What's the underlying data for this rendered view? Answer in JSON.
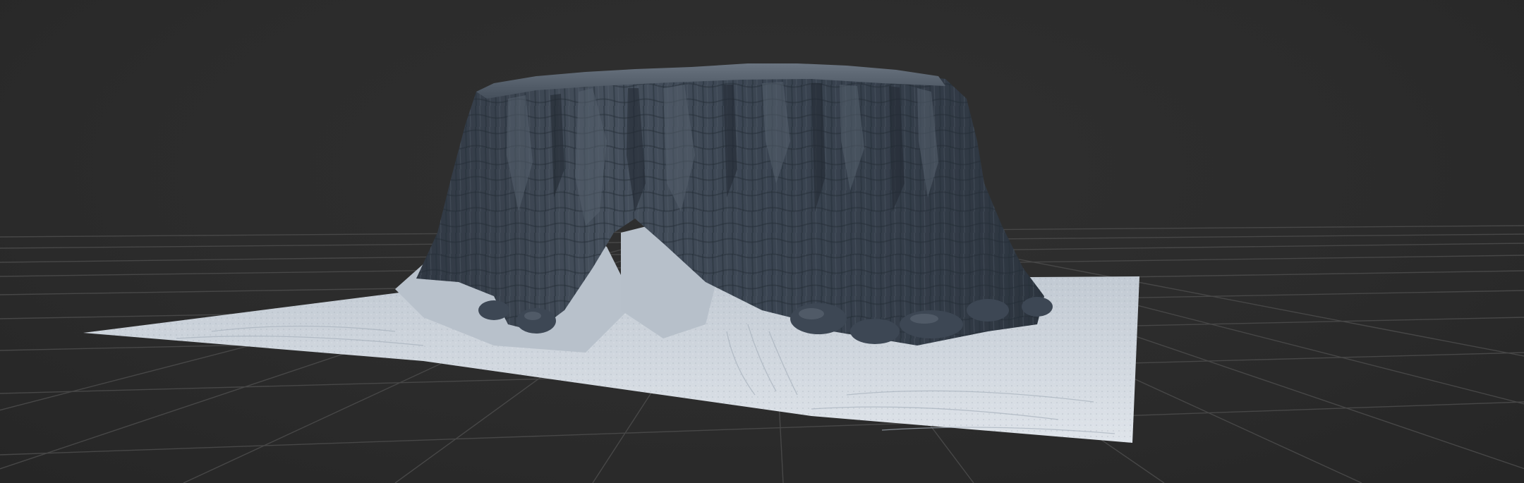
{
  "viewport": {
    "background_color": "#2d2d2d",
    "grid_color": "#474747",
    "terrain_base_color": "#c9d1da",
    "mesa_color": "#3a4452"
  },
  "scene": {
    "objects": [
      {
        "name": "terrain-mesh",
        "type": "heightfield",
        "shading": "matcap-grey-blue"
      },
      {
        "name": "ground-grid",
        "type": "grid"
      }
    ]
  }
}
